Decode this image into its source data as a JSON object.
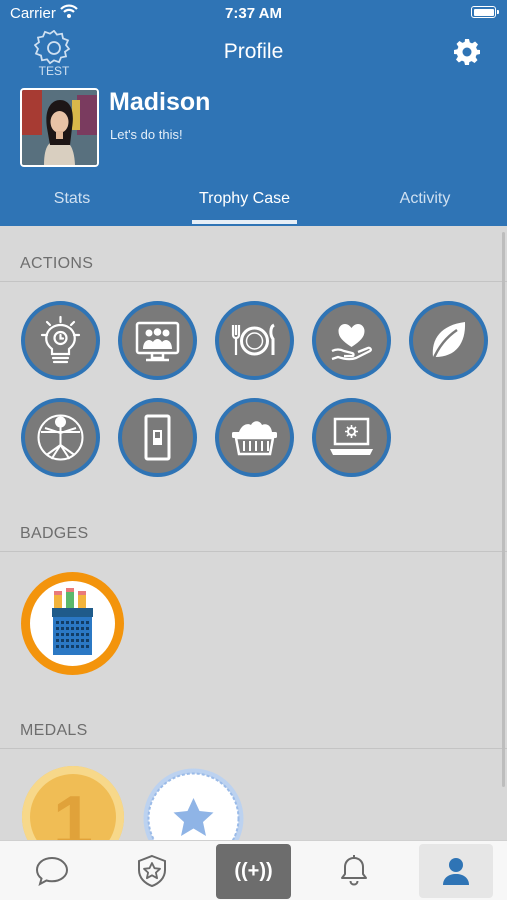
{
  "status_bar": {
    "carrier": "Carrier",
    "time": "7:37 AM"
  },
  "header": {
    "title": "Profile",
    "test_label": "TEST"
  },
  "user": {
    "name": "Madison",
    "status": "Let's do this!"
  },
  "tabs": [
    {
      "label": "Stats",
      "active": false
    },
    {
      "label": "Trophy Case",
      "active": true
    },
    {
      "label": "Activity",
      "active": false
    }
  ],
  "sections": {
    "actions": "ACTIONS",
    "badges": "BADGES",
    "medals": "MEDALS"
  },
  "actions": [
    {
      "icon": "lightbulb-clock-icon"
    },
    {
      "icon": "video-meeting-icon"
    },
    {
      "icon": "plate-utensils-icon"
    },
    {
      "icon": "heart-hand-icon"
    },
    {
      "icon": "leaf-icon"
    },
    {
      "icon": "vitruvian-man-icon"
    },
    {
      "icon": "light-switch-icon"
    },
    {
      "icon": "laundry-basket-icon"
    },
    {
      "icon": "laptop-settings-icon"
    }
  ],
  "badges": [
    {
      "icon": "pencil-cup-icon"
    }
  ],
  "medals": [
    {
      "icon": "gold-number-one-medal-icon",
      "label": "1"
    },
    {
      "icon": "blue-star-medal-icon"
    }
  ],
  "tab_bar": {
    "items": [
      "chat-icon",
      "shield-star-icon",
      "broadcast-plus-icon",
      "bell-icon",
      "profile-icon"
    ],
    "center_label": "((+))",
    "selected": "profile-icon"
  },
  "colors": {
    "header_blue": "#2f74b5",
    "action_gray": "#7a7a7a",
    "badge_orange": "#f3940c",
    "medal_gold": "#f1c45e",
    "medal_blue": "#8fb4e6"
  }
}
